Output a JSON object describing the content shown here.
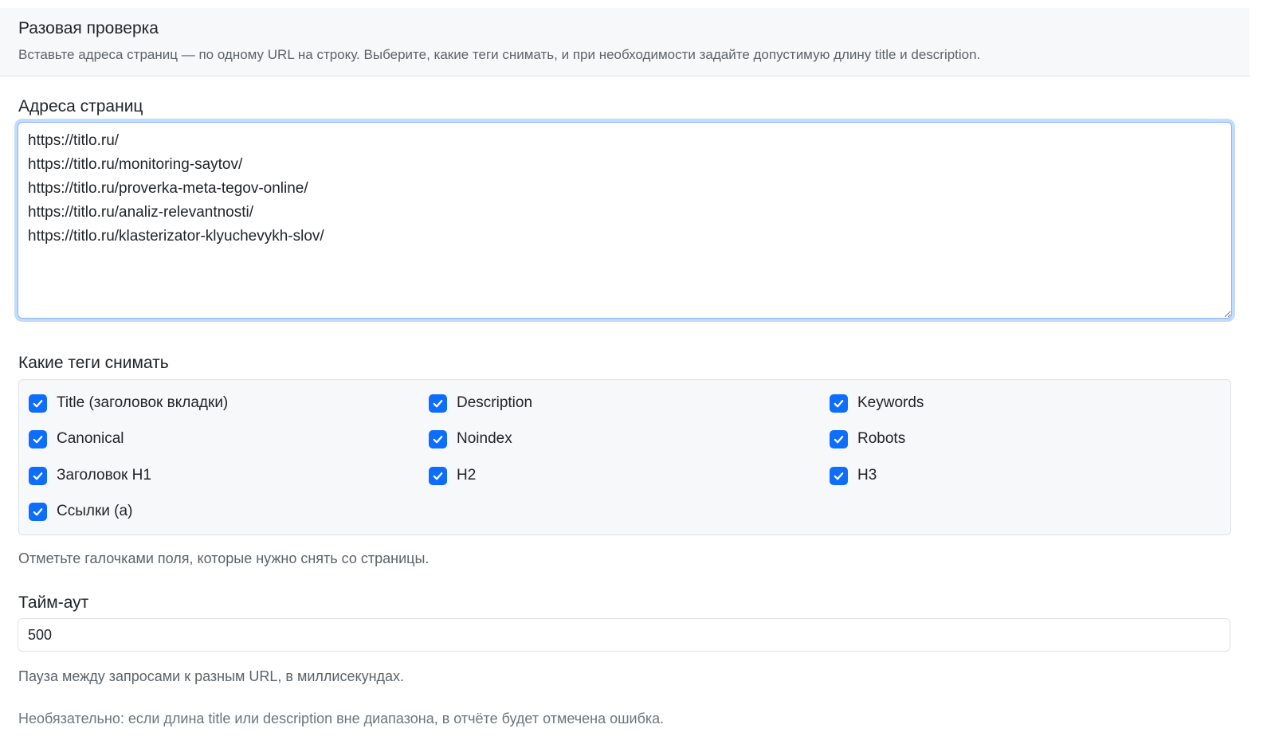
{
  "header": {
    "title": "Разовая проверка",
    "subtitle": "Вставьте адреса страниц — по одному URL на строку. Выберите, какие теги снимать, и при необходимости задайте допустимую длину title и description."
  },
  "urls": {
    "label": "Адреса страниц",
    "value": "https://titlo.ru/\nhttps://titlo.ru/monitoring-saytov/\nhttps://titlo.ru/proverka-meta-tegov-online/\nhttps://titlo.ru/analiz-relevantnosti/\nhttps://titlo.ru/klasterizator-klyuchevykh-slov/"
  },
  "tags": {
    "label": "Какие теги снимать",
    "items": [
      {
        "label": "Title (заголовок вкладки)",
        "checked": true
      },
      {
        "label": "Description",
        "checked": true
      },
      {
        "label": "Keywords",
        "checked": true
      },
      {
        "label": "Canonical",
        "checked": true
      },
      {
        "label": "Noindex",
        "checked": true
      },
      {
        "label": "Robots",
        "checked": true
      },
      {
        "label": "Заголовок H1",
        "checked": true
      },
      {
        "label": "H2",
        "checked": true
      },
      {
        "label": "H3",
        "checked": true
      },
      {
        "label": "Ссылки (a)",
        "checked": true
      }
    ],
    "hint": "Отметьте галочками поля, которые нужно снять со страницы."
  },
  "timeout": {
    "label": "Тайм-аут",
    "value": "500",
    "hint": "Пауза между запросами к разным URL, в миллисекундах."
  },
  "optional_note": "Необязательно: если длина title или description вне диапазона, в отчёте будет отмечена ошибка.",
  "colors": {
    "accent": "#0d6efd",
    "muted_text": "#5c636a",
    "panel_bg": "#f7f8f9"
  }
}
